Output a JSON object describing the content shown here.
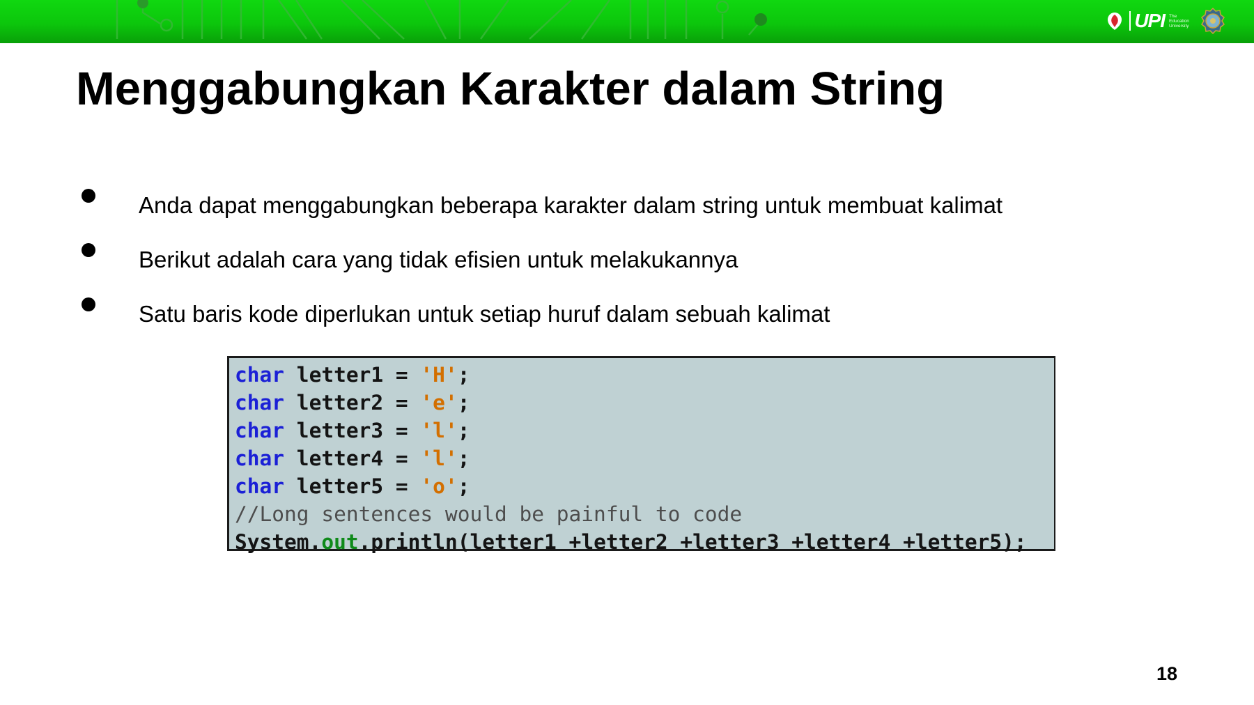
{
  "header": {
    "logo_text": "UPI",
    "logo_tagline": [
      "The",
      "Education",
      "University"
    ]
  },
  "slide": {
    "title": "Menggabungkan Karakter dalam String",
    "bullets": [
      "Anda dapat menggabungkan beberapa karakter dalam string untuk membuat kalimat",
      "Berikut adalah cara yang tidak efisien untuk melakukannya",
      "Satu baris kode diperlukan untuk setiap huruf dalam sebuah kalimat"
    ],
    "page_number": "18"
  },
  "code": {
    "lines": [
      [
        {
          "t": "char",
          "k": "kw"
        },
        {
          "t": " letter1 = ",
          "k": ""
        },
        {
          "t": "'H'",
          "k": "str"
        },
        {
          "t": ";",
          "k": ""
        }
      ],
      [
        {
          "t": "char",
          "k": "kw"
        },
        {
          "t": " letter2 = ",
          "k": ""
        },
        {
          "t": "'e'",
          "k": "str"
        },
        {
          "t": ";",
          "k": ""
        }
      ],
      [
        {
          "t": "char",
          "k": "kw"
        },
        {
          "t": " letter3 = ",
          "k": ""
        },
        {
          "t": "'l'",
          "k": "str"
        },
        {
          "t": ";",
          "k": ""
        }
      ],
      [
        {
          "t": "char",
          "k": "kw"
        },
        {
          "t": " letter4 = ",
          "k": ""
        },
        {
          "t": "'l'",
          "k": "str"
        },
        {
          "t": ";",
          "k": ""
        }
      ],
      [
        {
          "t": "char",
          "k": "kw"
        },
        {
          "t": " letter5 = ",
          "k": ""
        },
        {
          "t": "'o'",
          "k": "str"
        },
        {
          "t": ";",
          "k": ""
        }
      ],
      [
        {
          "t": "//Long sentences would be painful to code",
          "k": "cmt"
        }
      ],
      [
        {
          "t": "System.",
          "k": ""
        },
        {
          "t": "out",
          "k": "fld"
        },
        {
          "t": ".println(letter1 +letter2 +letter3 +letter4 +letter5);",
          "k": ""
        }
      ]
    ]
  },
  "colors": {
    "header_green": "#0cc60c",
    "code_background": "#bfd1d3",
    "keyword": "#1b20d6",
    "string_literal": "#d36f00",
    "comment": "#4d4d4d",
    "field": "#0f8a1a"
  }
}
